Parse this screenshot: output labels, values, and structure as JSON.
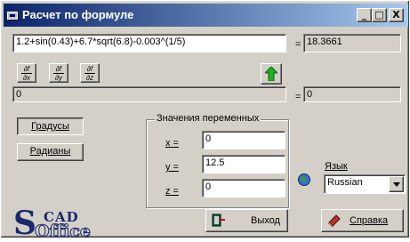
{
  "window": {
    "title": "Расчет по формуле",
    "minimize": "_",
    "maximize": "□",
    "close": "X"
  },
  "formula": {
    "expression": "1.2+sin(0.43)+6.7*sqrt(6.8)-0.003^(1/5)",
    "equals": "=",
    "result": "18.3661"
  },
  "derivatives": {
    "dx": {
      "num": "∂f",
      "den": "∂x"
    },
    "dy": {
      "num": "∂f",
      "den": "∂y"
    },
    "dz": {
      "num": "∂f",
      "den": "∂z"
    },
    "expression": "0",
    "equals": "=",
    "result": "0"
  },
  "angle_units": {
    "degrees": "Градусы",
    "radians": "Радианы"
  },
  "variables": {
    "caption": "Значения переменных",
    "x_label": "x =",
    "x_value": "0",
    "y_label": "y =",
    "y_value": "12.5",
    "z_label": "z =",
    "z_value": "0"
  },
  "language": {
    "label": "Язык",
    "selected": "Russian"
  },
  "buttons": {
    "exit": "Выход",
    "help": "Справка"
  },
  "logo": {
    "s": "S",
    "cad": "CAD",
    "office": "Office"
  }
}
